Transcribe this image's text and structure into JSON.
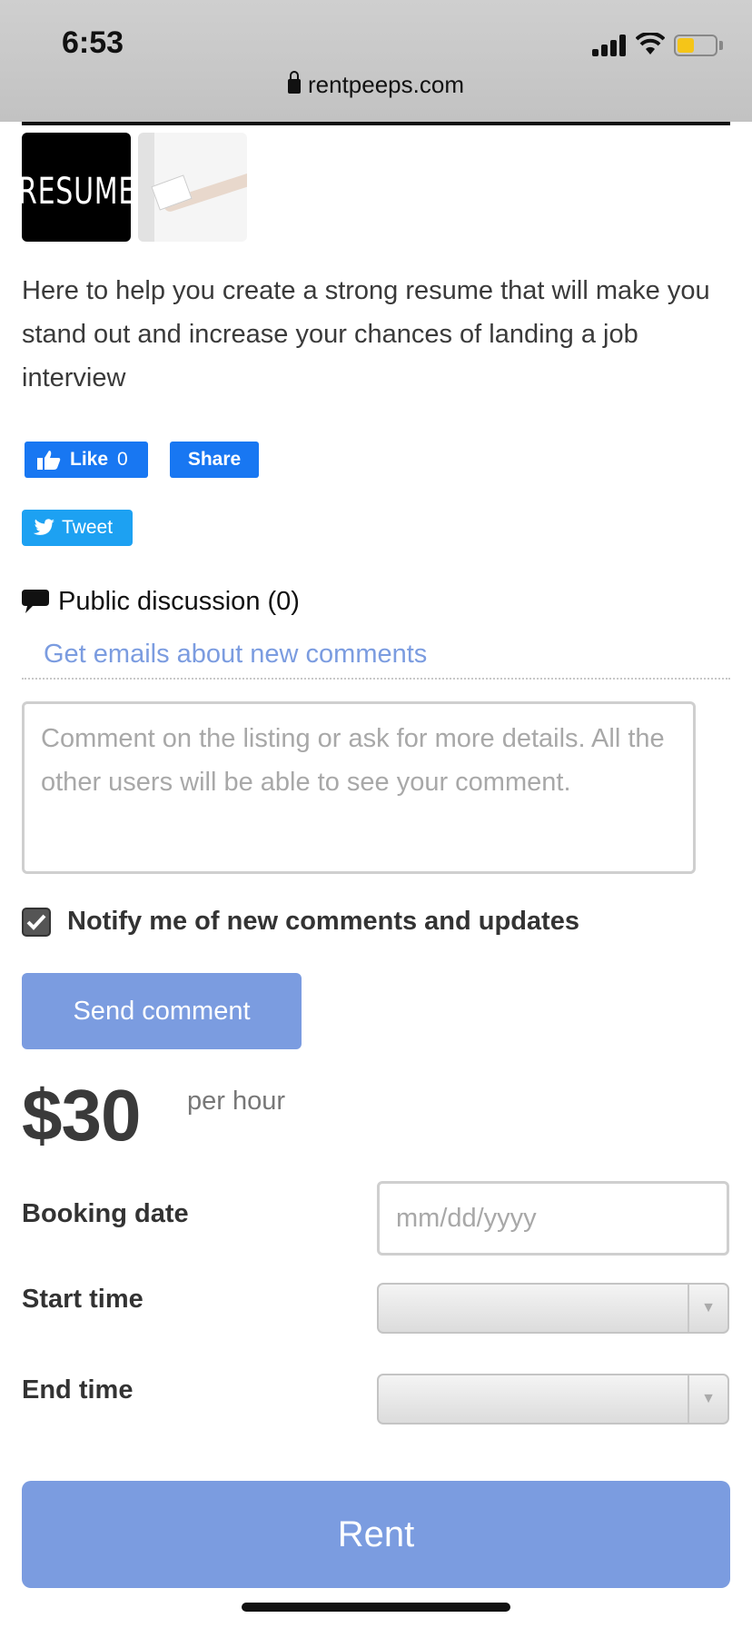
{
  "status_bar": {
    "time": "6:53",
    "url": "rentpeeps.com"
  },
  "gallery": [
    {
      "label": "RESUME",
      "icon": "resume-image"
    },
    {
      "icon": "handing-paper-image"
    }
  ],
  "listing": {
    "description": "Here to help you create a strong resume that will make you stand out and increase your chances of landing a job interview"
  },
  "social": {
    "like_label": "Like",
    "like_count": "0",
    "share_label": "Share",
    "tweet_label": "Tweet",
    "colors": {
      "facebook": "#1877f2",
      "twitter": "#1da1f2"
    }
  },
  "discussion": {
    "title": "Public discussion (0)",
    "emails_link": "Get emails about new comments",
    "comment_placeholder": "Comment on the listing or ask for more details. All the other users will be able to see your comment.",
    "notify_label": "Notify me of new comments and updates",
    "notify_checked": true,
    "send_label": "Send comment"
  },
  "pricing": {
    "price": "$30",
    "unit": "per hour"
  },
  "booking": {
    "date_label": "Booking date",
    "date_placeholder": "mm/dd/yyyy",
    "start_label": "Start time",
    "start_value": "",
    "end_label": "End time",
    "end_value": "",
    "rent_label": "Rent"
  },
  "theme": {
    "accent": "#7b9ce0",
    "text": "#3a3a3a"
  }
}
